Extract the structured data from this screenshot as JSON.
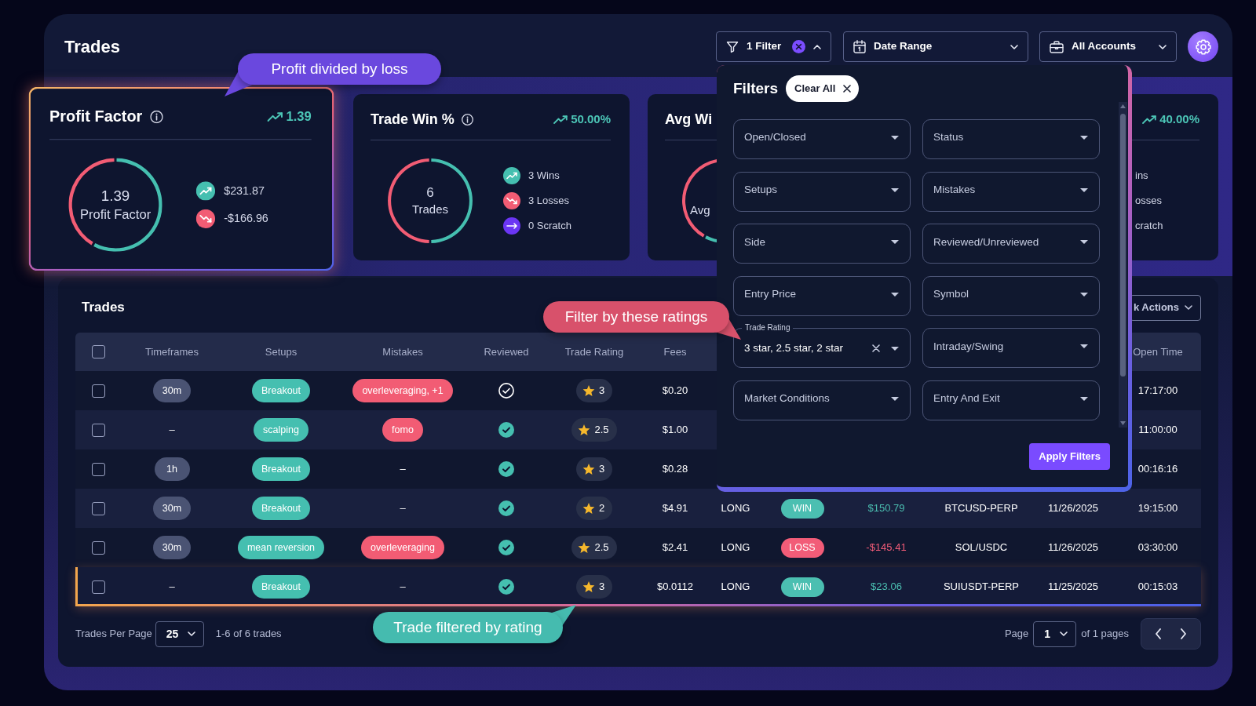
{
  "header": {
    "title": "Trades",
    "filter": {
      "label": "1 Filter",
      "expanded": true
    },
    "date_range": "Date Range",
    "accounts": "All Accounts"
  },
  "stats": [
    {
      "kind": "full",
      "highlighted": true,
      "title": "Profit Factor",
      "trend": "1.39",
      "ring": {
        "value": "1.39",
        "label": "Profit Factor",
        "chart_data": {
          "type": "donut",
          "values": [
            58.14,
            41.86
          ]
        }
      },
      "legend": [
        {
          "kind": "up",
          "text": "$231.87"
        },
        {
          "kind": "down",
          "text": "-$166.96"
        }
      ]
    },
    {
      "kind": "full",
      "highlighted": false,
      "title": "Trade Win %",
      "trend": "50.00%",
      "ring": {
        "value": "6",
        "label": "Trades",
        "chart_data": {
          "type": "donut",
          "values": [
            50,
            50,
            0
          ]
        }
      },
      "legend": [
        {
          "kind": "up",
          "text": "3 Wins"
        },
        {
          "kind": "down",
          "text": "3 Losses"
        },
        {
          "kind": "flat",
          "text": "0 Scratch"
        }
      ]
    },
    {
      "kind": "cut_right",
      "highlighted": false,
      "title": "Avg Wi",
      "ring": {
        "label": "Avg"
      }
    },
    {
      "kind": "cut_left",
      "highlighted": false,
      "trend": "40.00%",
      "legend": [
        {
          "text": "ins"
        },
        {
          "text": "osses"
        },
        {
          "text": "cratch"
        }
      ]
    }
  ],
  "filters": {
    "title": "Filters",
    "clear_all": "Clear All",
    "fields": [
      {
        "label": "Open/Closed"
      },
      {
        "label": "Status"
      },
      {
        "label": "Setups"
      },
      {
        "label": "Mistakes"
      },
      {
        "label": "Side"
      },
      {
        "label": "Reviewed/Unreviewed"
      },
      {
        "label": "Entry Price"
      },
      {
        "label": "Symbol"
      },
      {
        "label": "Trade Rating",
        "value": "3 star, 2.5 star, 2 star"
      },
      {
        "label": "Intraday/Swing"
      },
      {
        "label": "Market Conditions"
      },
      {
        "label": "Entry And Exit"
      }
    ],
    "apply": "Apply Filters"
  },
  "trades": {
    "title": "Trades",
    "bulk_actions": "k Actions",
    "all_selected": false,
    "columns": [
      "Timeframes",
      "Setups",
      "Mistakes",
      "Reviewed",
      "Trade Rating",
      "Fees",
      null,
      null,
      null,
      null,
      null,
      "Open Time"
    ],
    "rows": [
      {
        "selected": false,
        "highlighted": false,
        "timeframe": {
          "kind": "tag",
          "text": "30m"
        },
        "setup": "Breakout",
        "mistakes": {
          "kind": "tag",
          "text": "overleveraging, +1"
        },
        "reviewed": false,
        "rating": "3",
        "fees": "$0.20",
        "open_time": "17:17:00"
      },
      {
        "selected": false,
        "highlighted": false,
        "timeframe": {
          "kind": "plain",
          "text": "–"
        },
        "setup": "scalping",
        "mistakes": {
          "kind": "tag",
          "text": "fomo"
        },
        "reviewed": true,
        "rating": "2.5",
        "fees": "$1.00",
        "open_time": "11:00:00"
      },
      {
        "selected": false,
        "highlighted": false,
        "timeframe": {
          "kind": "tag",
          "text": "1h"
        },
        "setup": "Breakout",
        "mistakes": {
          "kind": "plain",
          "text": "–"
        },
        "reviewed": true,
        "rating": "3",
        "fees": "$0.28",
        "open_time": "00:16:16"
      },
      {
        "selected": false,
        "highlighted": false,
        "timeframe": {
          "kind": "tag",
          "text": "30m"
        },
        "setup": "Breakout",
        "mistakes": {
          "kind": "plain",
          "text": "–"
        },
        "reviewed": true,
        "rating": "2",
        "fees": "$4.91",
        "side": "LONG",
        "result": {
          "text": "WIN",
          "color": "#4bbfb1"
        },
        "pnl": {
          "text": "$150.79",
          "color": "#4bbfb1"
        },
        "symbol": "BTCUSD-PERP",
        "open_date": "11/26/2025",
        "open_time": "19:15:00"
      },
      {
        "selected": false,
        "highlighted": false,
        "timeframe": {
          "kind": "tag",
          "text": "30m"
        },
        "setup": "mean reversion",
        "mistakes": {
          "kind": "tag",
          "text": "overleveraging"
        },
        "reviewed": true,
        "rating": "2.5",
        "fees": "$2.41",
        "side": "LONG",
        "result": {
          "text": "LOSS",
          "color": "#f25c78"
        },
        "pnl": {
          "text": "-$145.41",
          "color": "#f25c78"
        },
        "symbol": "SOL/USDC",
        "open_date": "11/26/2025",
        "open_time": "03:30:00"
      },
      {
        "selected": false,
        "highlighted": true,
        "timeframe": {
          "kind": "plain",
          "text": "–"
        },
        "setup": "Breakout",
        "mistakes": {
          "kind": "plain",
          "text": "–"
        },
        "reviewed": true,
        "rating": "3",
        "fees": "$0.0112",
        "side": "LONG",
        "result": {
          "text": "WIN",
          "color": "#4bbfb1"
        },
        "pnl": {
          "text": "$23.06",
          "color": "#4bbfb1"
        },
        "symbol": "SUIUSDT-PERP",
        "open_date": "11/25/2025",
        "open_time": "00:15:03"
      }
    ]
  },
  "footer": {
    "per_page_label": "Trades Per Page",
    "per_page": "25",
    "count": "1-6 of 6 trades",
    "page_label": "Page",
    "page": "1",
    "page_total": "of 1 pages"
  },
  "callouts": [
    {
      "text": "Profit divided by loss",
      "color": "#6a48de"
    },
    {
      "text": "Filter by these ratings",
      "color": "#d8516b"
    },
    {
      "text": "Trade filtered by rating",
      "color": "#45bbaf"
    }
  ]
}
